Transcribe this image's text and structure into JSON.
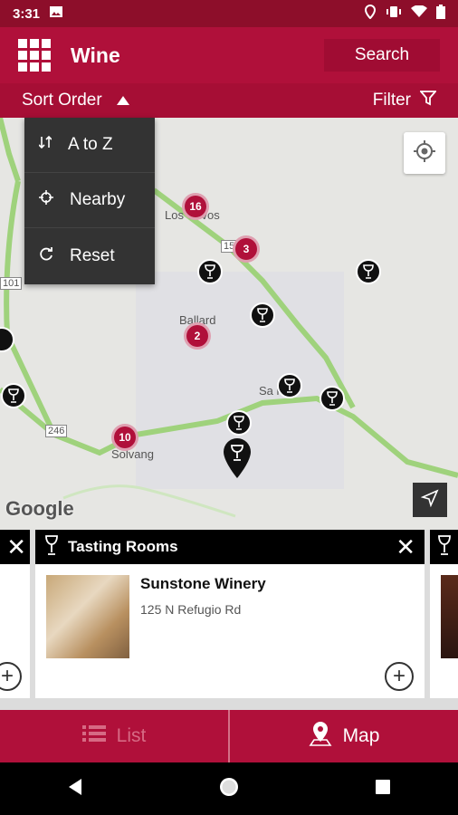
{
  "status": {
    "time": "3:31"
  },
  "appbar": {
    "title": "Wine",
    "search_label": "Search"
  },
  "sortbar": {
    "sort_label": "Sort Order",
    "filter_label": "Filter"
  },
  "sort_menu": {
    "items": [
      {
        "label": "A to Z",
        "icon": "sort-icon"
      },
      {
        "label": "Nearby",
        "icon": "crosshair-icon"
      },
      {
        "label": "Reset",
        "icon": "refresh-icon"
      }
    ]
  },
  "map": {
    "labels": {
      "los_olivos": "Los Olivos",
      "ballard": "Ballard",
      "solvang": "Solvang",
      "santa_ynez": "Sa      ne",
      "road_154": "154",
      "road_246": "246",
      "road_101": "101"
    },
    "clusters": {
      "c16": "16",
      "c3": "3",
      "c2": "2",
      "c10": "10"
    },
    "attribution": "Google"
  },
  "cards": {
    "category": "Tasting Rooms",
    "winery_name": "Sunstone Winery",
    "winery_address": "125 N Refugio Rd"
  },
  "bottomnav": {
    "list_label": "List",
    "map_label": "Map"
  },
  "colors": {
    "brand": "#b0103a",
    "status": "#8d0e2a",
    "dark": "#333333"
  }
}
